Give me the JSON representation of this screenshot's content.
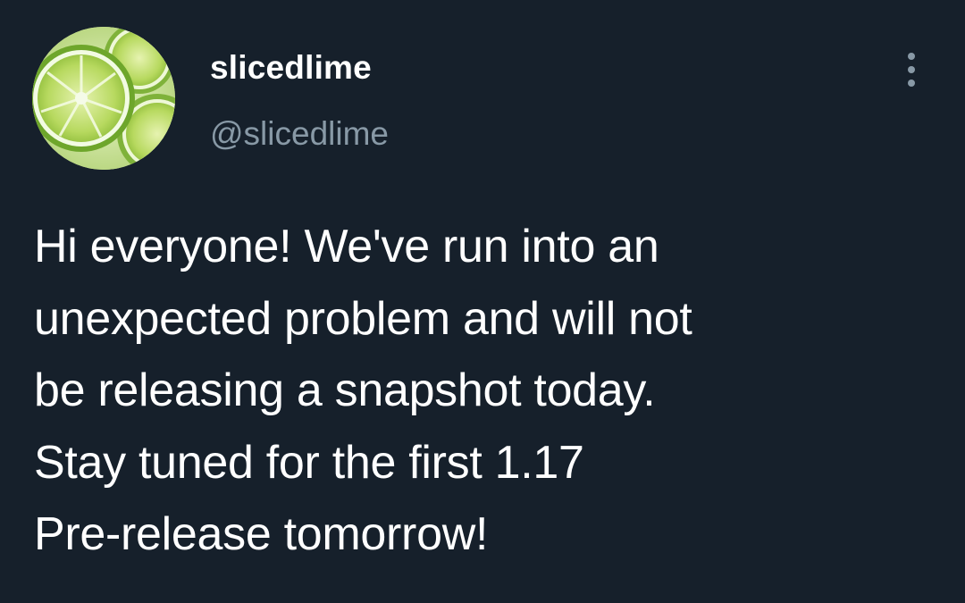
{
  "colors": {
    "background": "#15202b",
    "primary_text": "#ffffff",
    "secondary_text": "#8899a6",
    "avatar_lime": "#a8d45a"
  },
  "author": {
    "avatar_icon": "lime-slices-avatar",
    "display_name": "slicedlime",
    "handle": "@slicedlime"
  },
  "menu": {
    "icon": "more-vertical-icon"
  },
  "tweet": {
    "lines": [
      "Hi everyone! We've run into an",
      "unexpected problem and will not",
      "be releasing a snapshot today.",
      "Stay tuned for the first 1.17",
      "Pre-release tomorrow!"
    ]
  }
}
